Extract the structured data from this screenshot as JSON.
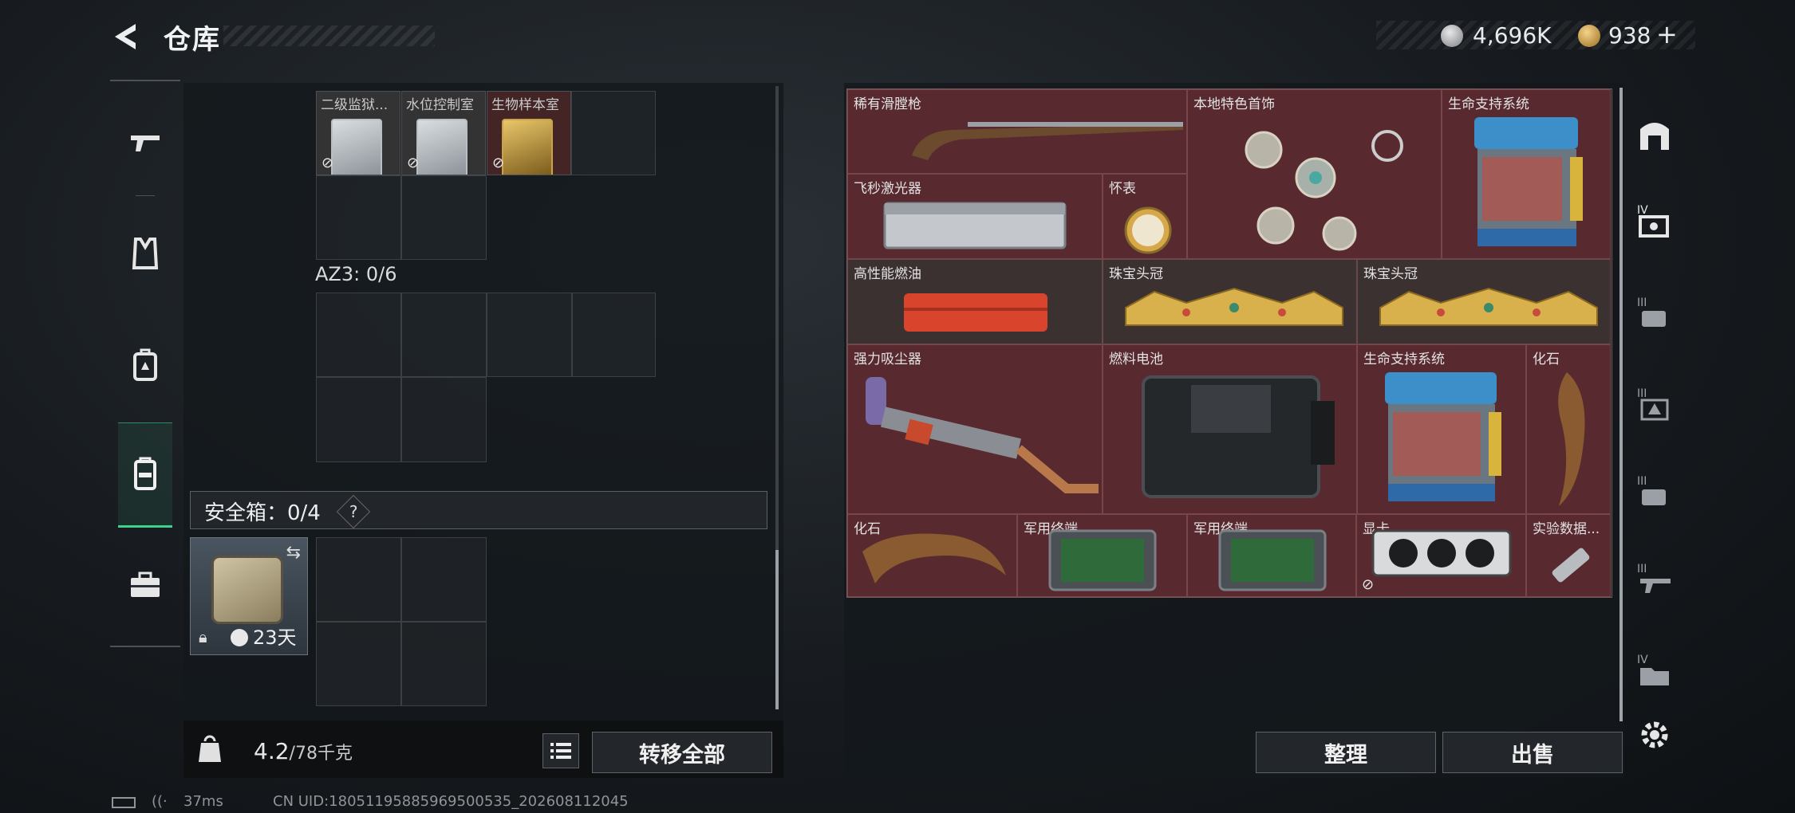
{
  "header": {
    "title": "仓库",
    "back_icon": "back-arrow-icon"
  },
  "currency": {
    "silver": "4,696K",
    "gold": "938",
    "add": "+"
  },
  "left_nav": [
    {
      "icon": "gun-icon"
    },
    {
      "icon": "armor-icon"
    },
    {
      "icon": "backpack-icon"
    },
    {
      "icon": "chest-rig-icon",
      "active": true
    },
    {
      "icon": "toolbox-icon"
    }
  ],
  "left_items": [
    {
      "label": "二级监狱..."
    },
    {
      "label": "水位控制室"
    },
    {
      "label": "生物样本室"
    }
  ],
  "az3_label": "AZ3: 0/6",
  "safe": {
    "label": "安全箱：0/4",
    "help": "?",
    "days": "23天"
  },
  "weight": {
    "value": "4.2",
    "max": "/78千克"
  },
  "buttons": {
    "transfer_all": "转移全部",
    "organize": "整理",
    "sell": "出售"
  },
  "right_items": [
    {
      "label": "稀有滑膛枪"
    },
    {
      "label": "本地特色首饰"
    },
    {
      "label": "生命支持系统"
    },
    {
      "label": "飞秒激光器"
    },
    {
      "label": "怀表"
    },
    {
      "label": "高性能燃油"
    },
    {
      "label": "珠宝头冠"
    },
    {
      "label": "珠宝头冠"
    },
    {
      "label": "强力吸尘器"
    },
    {
      "label": "燃料电池"
    },
    {
      "label": "生命支持系统"
    },
    {
      "label": "化石"
    },
    {
      "label": "化石"
    },
    {
      "label": "军用终端..."
    },
    {
      "label": "军用终端..."
    },
    {
      "label": "显卡"
    },
    {
      "label": "实验数据..."
    }
  ],
  "right_nav": [
    {
      "icon": "vault-icon"
    },
    {
      "icon": "level4-case-icon"
    },
    {
      "icon": "level3-hand-icon"
    },
    {
      "icon": "level3-warning-icon"
    },
    {
      "icon": "level3-hand2-icon"
    },
    {
      "icon": "level3-gun-icon"
    },
    {
      "icon": "level4-folder-icon"
    },
    {
      "icon": "gear-icon"
    }
  ],
  "status": {
    "ping": "37ms",
    "uid": "CN UID:18051195885969500535_202608112045"
  }
}
